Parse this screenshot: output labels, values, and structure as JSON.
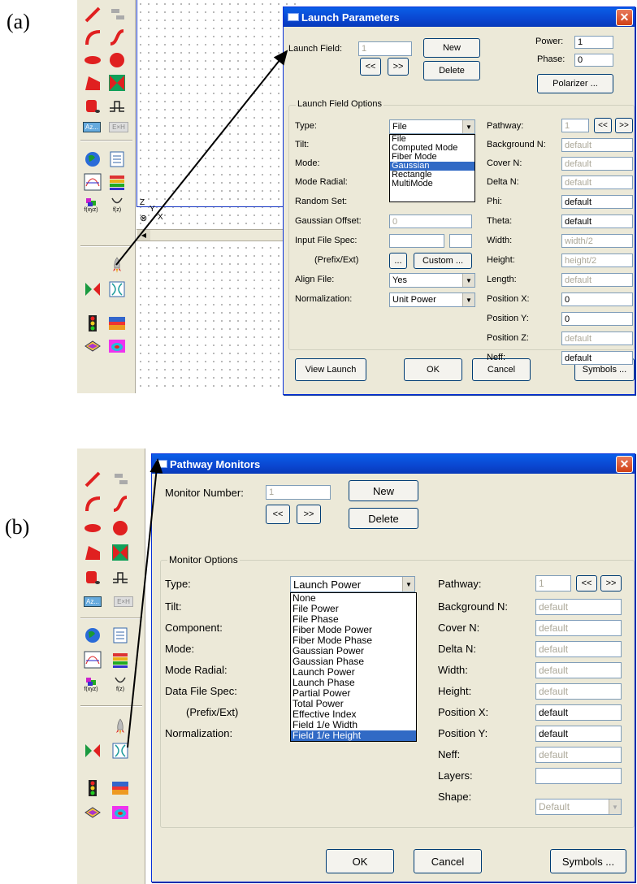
{
  "panel_a": {
    "label": "(a)",
    "dialog": {
      "title": "Launch Parameters",
      "launch_field_label": "Launch Field:",
      "launch_field_value": "1",
      "new_label": "New",
      "delete_label": "Delete",
      "prev_label": "<<",
      "next_label": ">>",
      "power_label": "Power:",
      "power_value": "1",
      "phase_label": "Phase:",
      "phase_value": "0",
      "polarizer_label": "Polarizer ...",
      "group_title": "Launch Field Options",
      "left_labels": [
        "Type:",
        "Tilt:",
        "Mode:",
        "Mode Radial:",
        "Random Set:",
        "Gaussian Offset:",
        "Input File Spec:",
        "(Prefix/Ext)",
        "Align File:",
        "Normalization:"
      ],
      "type_value": "File",
      "type_options": [
        "File",
        "Computed Mode",
        "Fiber Mode",
        "Gaussian",
        "Rectangle",
        "MultiMode"
      ],
      "type_highlighted": "Gaussian",
      "mode_radial_value": "0",
      "gaussian_offset_value": "0",
      "ellipsis_label": "...",
      "custom_label": "Custom ...",
      "align_file_value": "Yes",
      "normalization_value": "Unit Power",
      "right_labels": [
        "Pathway:",
        "Background N:",
        "Cover N:",
        "Delta N:",
        "Phi:",
        "Theta:",
        "Width:",
        "Height:",
        "Length:",
        "Position X:",
        "Position Y:",
        "Position Z:",
        "Neff:"
      ],
      "right_values": [
        "default",
        "default",
        "default",
        "default",
        "default",
        "width/2",
        "height/2",
        "default",
        "0",
        "0",
        "default",
        "default"
      ],
      "pathway_value": "1",
      "view_launch_label": "View Launch",
      "ok_label": "OK",
      "cancel_label": "Cancel",
      "symbols_label": "Symbols ..."
    },
    "axis_labels": {
      "z": "Z",
      "y": "Y",
      "x": "X"
    }
  },
  "panel_b": {
    "label": "(b)",
    "dialog": {
      "title": "Pathway Monitors",
      "monitor_number_label": "Monitor Number:",
      "monitor_number_value": "1",
      "new_label": "New",
      "delete_label": "Delete",
      "prev_label": "<<",
      "next_label": ">>",
      "group_title": "Monitor Options",
      "left_labels": [
        "Type:",
        "Tilt:",
        "Component:",
        "Mode:",
        "Mode Radial:",
        "Data File Spec:",
        "(Prefix/Ext)",
        "Normalization:"
      ],
      "type_value": "Launch Power",
      "type_options": [
        "None",
        "File Power",
        "File Phase",
        "Fiber Mode Power",
        "Fiber Mode Phase",
        "Gaussian Power",
        "Gaussian Phase",
        "Launch Power",
        "Launch Phase",
        "Partial Power",
        "Total Power",
        "Effective Index",
        "Field 1/e Width",
        "Field 1/e Height"
      ],
      "type_highlighted": "Field 1/e Height",
      "right_labels": [
        "Pathway:",
        "Background N:",
        "Cover N:",
        "Delta N:",
        "Width:",
        "Height:",
        "Position X:",
        "Position Y:",
        "Neff:",
        "Layers:",
        "Shape:"
      ],
      "right_values": [
        "default",
        "default",
        "default",
        "default",
        "default",
        "default",
        "default",
        "default",
        ""
      ],
      "pathway_value": "1",
      "shape_value": "Default",
      "ok_label": "OK",
      "cancel_label": "Cancel",
      "symbols_label": "Symbols ..."
    }
  },
  "toolbar_icons": [
    "line-segment-icon",
    "taper-icon",
    "arc-icon",
    "s-bend-icon",
    "lens-icon",
    "sphere-icon",
    "trapezoid-icon",
    "coupler-icon",
    "cylinder-icon",
    "step-icon",
    "az-button-icon",
    "exh-button-icon",
    "globe-icon",
    "document-icon",
    "mode-plot-icon",
    "layers-icon",
    "fxyz-icon",
    "fz-icon",
    "launch-rocket-icon",
    "monitor-icon",
    "pathway-monitor-icon",
    "traffic-light-icon",
    "profile-icon",
    "flat-mesh-icon",
    "contour-icon"
  ],
  "toolbar_text": {
    "az": "Az...",
    "exh": "E×H",
    "fxyz": "f(xyz)",
    "fz": "f(z)"
  }
}
